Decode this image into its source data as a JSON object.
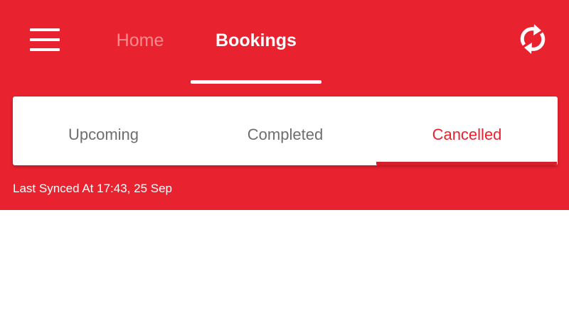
{
  "colors": {
    "primary_red": "#E8222F",
    "inactive_tab_text": "#FF8A8F",
    "segment_inactive_text": "#6e6e6e",
    "white": "#ffffff"
  },
  "header": {
    "menu_icon": "hamburger-menu-icon",
    "tabs": [
      {
        "label": "Home",
        "active": false
      },
      {
        "label": "Bookings",
        "active": true
      }
    ],
    "sync_icon": "refresh-sync-icon"
  },
  "booking_tabs": [
    {
      "label": "Upcoming",
      "active": false
    },
    {
      "label": "Completed",
      "active": false
    },
    {
      "label": "Cancelled",
      "active": true
    }
  ],
  "status": {
    "last_synced": "Last Synced At 17:43, 25 Sep"
  }
}
